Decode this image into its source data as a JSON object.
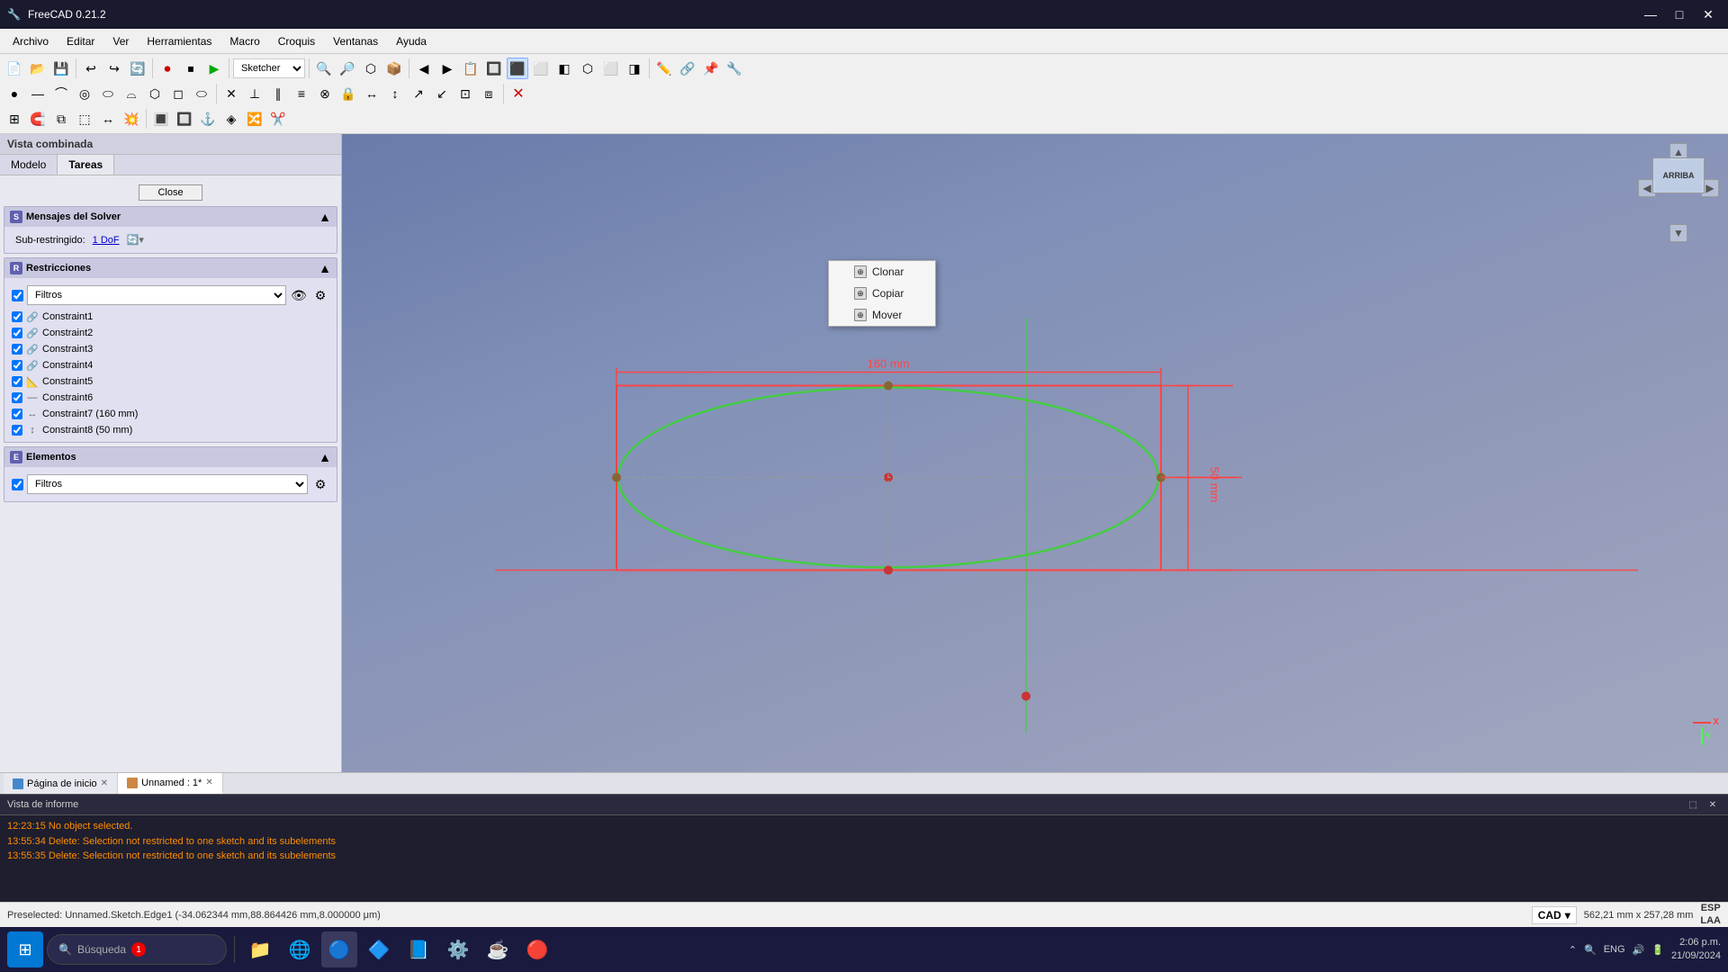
{
  "app": {
    "title": "FreeCAD 0.21.2",
    "icon": "🔧"
  },
  "title_bar": {
    "title": "FreeCAD 0.21.2",
    "minimize": "—",
    "maximize": "□",
    "close": "✕"
  },
  "menu": {
    "items": [
      "Archivo",
      "Editar",
      "Ver",
      "Herramientas",
      "Macro",
      "Croquis",
      "Ventanas",
      "Ayuda"
    ]
  },
  "toolbar": {
    "workbench": "Sketcher",
    "buttons": [
      "📄",
      "📂",
      "💾",
      "↩",
      "↪",
      "🔄",
      "⏺",
      "⏹",
      "▶"
    ]
  },
  "context_menu": {
    "items": [
      "Clonar",
      "Copiar",
      "Mover"
    ]
  },
  "left_panel": {
    "title": "Vista combinada",
    "tabs": [
      "Modelo",
      "Tareas"
    ],
    "active_tab": "Tareas",
    "close_button": "Close",
    "sections": {
      "solver": {
        "title": "Mensajes del Solver",
        "sub_label": "Sub-restringido:",
        "sub_value": "1 DoF"
      },
      "restricciones": {
        "title": "Restricciones",
        "filtros_label": "Filtros",
        "constraints": [
          {
            "name": "Constraint1",
            "icon": "🔗",
            "checked": true
          },
          {
            "name": "Constraint2",
            "icon": "🔗",
            "checked": true
          },
          {
            "name": "Constraint3",
            "icon": "🔗",
            "checked": true
          },
          {
            "name": "Constraint4",
            "icon": "🔗",
            "checked": true
          },
          {
            "name": "Constraint5",
            "icon": "📐",
            "checked": true
          },
          {
            "name": "Constraint6",
            "icon": "—",
            "checked": true
          },
          {
            "name": "Constraint7 (160 mm)",
            "icon": "↔",
            "checked": true
          },
          {
            "name": "Constraint8 (50 mm)",
            "icon": "↕",
            "checked": true
          }
        ]
      },
      "elementos": {
        "title": "Elementos",
        "filtros_label": "Filtros"
      }
    }
  },
  "canvas": {
    "sketch_width_label": "160 mm",
    "sketch_height_label": "50 mm",
    "viewport_label": "ARRIBA"
  },
  "bottom_tabs": [
    {
      "label": "Página de inicio",
      "type": "home",
      "closeable": true
    },
    {
      "label": "Unnamed : 1*",
      "type": "sketch",
      "closeable": true,
      "active": true
    }
  ],
  "report": {
    "title": "Vista de informe",
    "lines": [
      {
        "text": "12:23:15  No object selected.",
        "type": "orange"
      },
      {
        "text": "13:55:34  Delete: Selection not restricted to one sketch and its subelements",
        "type": "orange"
      },
      {
        "text": "13:55:35  Delete: Selection not restricted to one sketch and its subelements",
        "type": "orange"
      }
    ]
  },
  "status_bar": {
    "preselected": "Preselected: Unnamed.Sketch.Edge1 (-34.062344 mm,88.864426 mm,8.000000 μm)",
    "cad_label": "CAD",
    "coords": "562,21 mm x 257,28 mm",
    "lang_line1": "ESP",
    "lang_line2": "LAA"
  },
  "taskbar": {
    "search_placeholder": "Búsqueda",
    "notification_badge": "1",
    "time": "2:06 p.m.",
    "date": "21/09/2024",
    "apps": [
      "🪟",
      "🔍",
      "📁",
      "🌐",
      "🔵",
      "🔷",
      "📘",
      "⚙️",
      "☕",
      "🔴"
    ]
  }
}
